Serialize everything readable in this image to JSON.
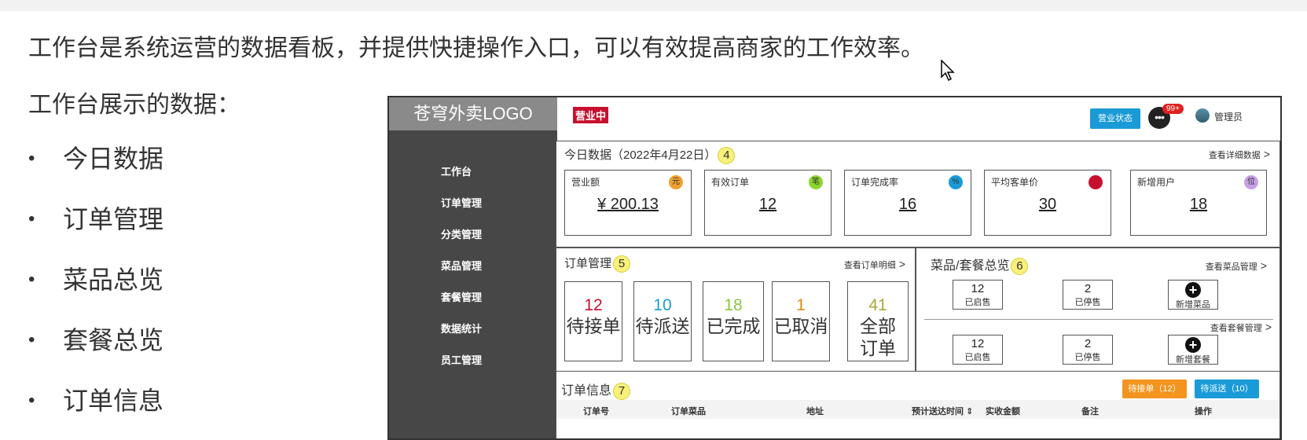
{
  "intro": "工作台是系统运营的数据看板，并提供快捷操作入口，可以有效提高商家的工作效率。",
  "subhead": "工作台展示的数据：",
  "bullets": [
    "今日数据",
    "订单管理",
    "菜品总览",
    "套餐总览",
    "订单信息"
  ],
  "mock": {
    "logo": "苍穹外卖LOGO",
    "nav": [
      "工作台",
      "订单管理",
      "分类管理",
      "菜品管理",
      "套餐管理",
      "数据统计",
      "员工管理"
    ],
    "header": {
      "status_tag": "营业中",
      "status_button": "营业状态",
      "msg_icon": "•••",
      "msg_badge": "99+",
      "admin": "管理员"
    },
    "today": {
      "title": "今日数据（2022年4月22日）",
      "badge": "4",
      "link": "查看详细数据",
      "cards": [
        {
          "label": "营业额",
          "icon": "元",
          "value": "¥ 200.13",
          "color": "#f0a030"
        },
        {
          "label": "有效订单",
          "icon": "笔",
          "value": "12",
          "color": "#8cd630"
        },
        {
          "label": "订单完成率",
          "icon": "%",
          "value": "16",
          "color": "#1a9bd7"
        },
        {
          "label": "平均客单价",
          "icon": "",
          "value": "30",
          "color": "#c8102e"
        },
        {
          "label": "新增用户",
          "icon": "位",
          "value": "18",
          "color": "#c9a0e6"
        }
      ]
    },
    "orders": {
      "title": "订单管理",
      "badge": "5",
      "link": "查看订单明细",
      "items": [
        {
          "num": "12",
          "label": "待接单",
          "color": "#c8102e"
        },
        {
          "num": "10",
          "label": "待派送",
          "color": "#1a9bd7"
        },
        {
          "num": "18",
          "label": "已完成",
          "color": "#8cc63f"
        },
        {
          "num": "1",
          "label": "已取消",
          "color": "#e08a1e"
        },
        {
          "num": "41",
          "label": "全部订单",
          "color": "#a8a83a"
        }
      ]
    },
    "dishes": {
      "title": "菜品/套餐总览",
      "badge": "6",
      "dish_link": "查看菜品管理",
      "setmeal_link": "查看套餐管理",
      "dish_on": {
        "num": "12",
        "label": "已启售"
      },
      "dish_off": {
        "num": "2",
        "label": "已停售"
      },
      "add_dish": "新增菜品",
      "set_on": {
        "num": "12",
        "label": "已启售"
      },
      "set_off": {
        "num": "2",
        "label": "已停售"
      },
      "add_set": "新增套餐"
    },
    "info": {
      "title": "订单信息",
      "badge": "7",
      "btn_pending": "待接单（12）",
      "btn_deliver": "待派送（10）",
      "btn_pending_color": "#f3941e",
      "btn_deliver_color": "#1a9bd7",
      "columns": [
        "订单号",
        "订单菜品",
        "地址",
        "预计送达时间 ⇕",
        "实收金额",
        "备注",
        "操作"
      ]
    }
  }
}
